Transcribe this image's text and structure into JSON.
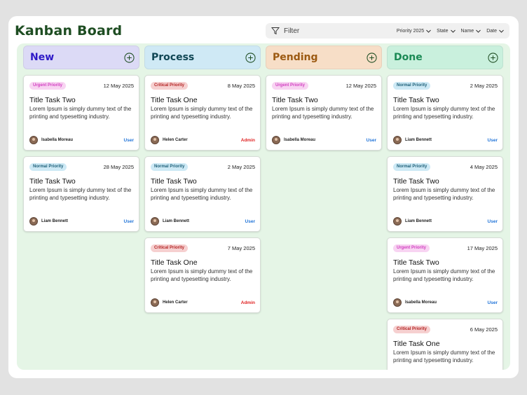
{
  "app": {
    "title": "Kanban Board"
  },
  "filter": {
    "label": "Filter",
    "options": [
      "Priority 2025",
      "State",
      "Name",
      "Date"
    ]
  },
  "colors": {
    "new_bg": "#dcdaf6",
    "new_text": "#2e19c7",
    "process_bg": "#cfe9f5",
    "process_text": "#0f4654",
    "pending_bg": "#f7dec7",
    "pending_text": "#9c5a12",
    "done_bg": "#c9f0dd",
    "done_text": "#1b8a55"
  },
  "columns": [
    {
      "title": "New",
      "cards": [
        {
          "priority": "Urgent Priority",
          "date": "12 May 2025",
          "title": "Title Task Two",
          "desc": "Lorem Ipsum is simply dummy text of the printing and typesetting industry.",
          "assignee": "Isabella Moreau",
          "role": "User"
        },
        {
          "priority": "Normal  Priority",
          "date": "28 May 2025",
          "title": "Title Task Two",
          "desc": "Lorem Ipsum is simply dummy text of the printing and typesetting industry.",
          "assignee": "Liam Bennett",
          "role": "User"
        }
      ]
    },
    {
      "title": "Process",
      "cards": [
        {
          "priority": "Critical Priority",
          "date": "8 May 2025",
          "title": "Title Task One",
          "desc": "Lorem Ipsum is simply dummy text of the printing and typesetting industry.",
          "assignee": "Helen Carter",
          "role": "Admin"
        },
        {
          "priority": "Normal  Priority",
          "date": "2 May 2025",
          "title": "Title Task Two",
          "desc": "Lorem Ipsum is simply dummy text of the printing and typesetting industry.",
          "assignee": "Liam Bennett",
          "role": "User"
        },
        {
          "priority": "Critical Priority",
          "date": "7 May 2025",
          "title": "Title Task One",
          "desc": "Lorem Ipsum is simply dummy text of the printing and typesetting industry.",
          "assignee": "Helen Carter",
          "role": "Admin"
        }
      ]
    },
    {
      "title": "Pending",
      "cards": [
        {
          "priority": "Urgent Priority",
          "date": "12 May 2025",
          "title": "Title Task Two",
          "desc": "Lorem Ipsum is simply dummy text of the printing and typesetting industry.",
          "assignee": "Isabella Moreau",
          "role": "User"
        }
      ]
    },
    {
      "title": "Done",
      "cards": [
        {
          "priority": "Normal  Priority",
          "date": "2 May 2025",
          "title": "Title Task Two",
          "desc": "Lorem Ipsum is simply dummy text of the printing and typesetting industry.",
          "assignee": "Liam Bennett",
          "role": "User"
        },
        {
          "priority": "Normal  Priority",
          "date": "4 May 2025",
          "title": "Title Task Two",
          "desc": "Lorem Ipsum is simply dummy text of the printing and typesetting industry.",
          "assignee": "Liam Bennett",
          "role": "User"
        },
        {
          "priority": "Urgent Priority",
          "date": "17 May 2025",
          "title": "Title Task Two",
          "desc": "Lorem Ipsum is simply dummy text of the printing and typesetting industry.",
          "assignee": "Isabella Moreau",
          "role": "User"
        },
        {
          "priority": "Critical Priority",
          "date": "6 May 2025",
          "title": "Title Task One",
          "desc": "Lorem Ipsum is simply dummy text of the printing and typesetting industry.",
          "assignee": "",
          "role": ""
        }
      ]
    }
  ]
}
